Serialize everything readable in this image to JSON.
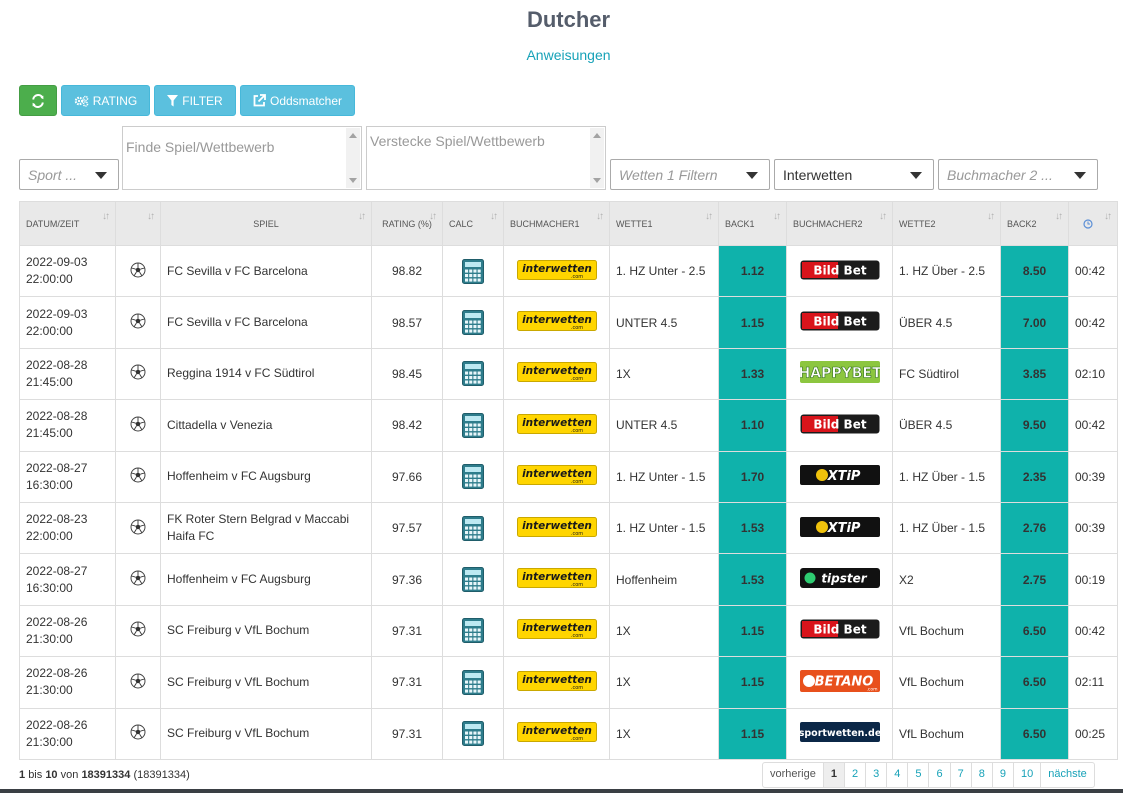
{
  "header": {
    "title": "Dutcher",
    "instructions_link": "Anweisungen"
  },
  "toolbar": {
    "refresh_icon": "refresh-icon",
    "rating_label": "RATING",
    "filter_label": "FILTER",
    "oddsmatcher_label": "Oddsmatcher"
  },
  "filters": {
    "sport_placeholder": "Sport ...",
    "find_game_placeholder": "Finde Spiel/Wettbewerb",
    "hide_game_placeholder": "Verstecke Spiel/Wettbewerb",
    "bets_filter_placeholder": "Wetten 1 Filtern",
    "bookmaker1_value": "Interwetten",
    "bookmaker2_placeholder": "Buchmacher 2 ..."
  },
  "table": {
    "columns": [
      "DATUM/ZEIT",
      "",
      "SPIEL",
      "RATING (%)",
      "CALC",
      "BUCHMACHER1",
      "WETTE1",
      "BACK1",
      "BUCHMACHER2",
      "WETTE2",
      "BACK2",
      ""
    ],
    "rows": [
      {
        "date": "2022-09-03",
        "time": "22:00:00",
        "game": "FC Sevilla v FC Barcelona",
        "rating": "98.82",
        "bm1": "interwetten",
        "bet1": "1. HZ Unter - 2.5",
        "back1": "1.12",
        "bm2": "bildbet",
        "bet2": "1. HZ Über - 2.5",
        "back2": "8.50",
        "age": "00:42"
      },
      {
        "date": "2022-09-03",
        "time": "22:00:00",
        "game": "FC Sevilla v FC Barcelona",
        "rating": "98.57",
        "bm1": "interwetten",
        "bet1": "UNTER 4.5",
        "back1": "1.15",
        "bm2": "bildbet",
        "bet2": "ÜBER 4.5",
        "back2": "7.00",
        "age": "00:42"
      },
      {
        "date": "2022-08-28",
        "time": "21:45:00",
        "game": "Reggina 1914 v FC Südtirol",
        "rating": "98.45",
        "bm1": "interwetten",
        "bet1": "1X",
        "back1": "1.33",
        "bm2": "happybet",
        "bet2": "FC Südtirol",
        "back2": "3.85",
        "age": "02:10"
      },
      {
        "date": "2022-08-28",
        "time": "21:45:00",
        "game": "Cittadella v Venezia",
        "rating": "98.42",
        "bm1": "interwetten",
        "bet1": "UNTER 4.5",
        "back1": "1.10",
        "bm2": "bildbet",
        "bet2": "ÜBER 4.5",
        "back2": "9.50",
        "age": "00:42"
      },
      {
        "date": "2022-08-27",
        "time": "16:30:00",
        "game": "Hoffenheim v FC Augsburg",
        "rating": "97.66",
        "bm1": "interwetten",
        "bet1": "1. HZ Unter - 1.5",
        "back1": "1.70",
        "bm2": "xtip",
        "bet2": "1. HZ Über - 1.5",
        "back2": "2.35",
        "age": "00:39"
      },
      {
        "date": "2022-08-23",
        "time": "22:00:00",
        "game": "FK Roter Stern Belgrad v Maccabi Haifa FC",
        "rating": "97.57",
        "bm1": "interwetten",
        "bet1": "1. HZ Unter - 1.5",
        "back1": "1.53",
        "bm2": "xtip",
        "bet2": "1. HZ Über - 1.5",
        "back2": "2.76",
        "age": "00:39"
      },
      {
        "date": "2022-08-27",
        "time": "16:30:00",
        "game": "Hoffenheim v FC Augsburg",
        "rating": "97.36",
        "bm1": "interwetten",
        "bet1": "Hoffenheim",
        "back1": "1.53",
        "bm2": "tipster",
        "bet2": "X2",
        "back2": "2.75",
        "age": "00:19"
      },
      {
        "date": "2022-08-26",
        "time": "21:30:00",
        "game": "SC Freiburg v VfL Bochum",
        "rating": "97.31",
        "bm1": "interwetten",
        "bet1": "1X",
        "back1": "1.15",
        "bm2": "bildbet",
        "bet2": "VfL Bochum",
        "back2": "6.50",
        "age": "00:42"
      },
      {
        "date": "2022-08-26",
        "time": "21:30:00",
        "game": "SC Freiburg v VfL Bochum",
        "rating": "97.31",
        "bm1": "interwetten",
        "bet1": "1X",
        "back1": "1.15",
        "bm2": "betano",
        "bet2": "VfL Bochum",
        "back2": "6.50",
        "age": "02:11"
      },
      {
        "date": "2022-08-26",
        "time": "21:30:00",
        "game": "SC Freiburg v VfL Bochum",
        "rating": "97.31",
        "bm1": "interwetten",
        "bet1": "1X",
        "back1": "1.15",
        "bm2": "sportwetten",
        "bet2": "VfL Bochum",
        "back2": "6.50",
        "age": "00:25"
      }
    ]
  },
  "logos": {
    "interwetten": {
      "text": "interwetten",
      "sub": ".com"
    },
    "bildbet": {
      "text": "Bild Bet"
    },
    "happybet": {
      "text": "HAPPYBET"
    },
    "xtip": {
      "text": "XTiP"
    },
    "tipster": {
      "text": "tipster"
    },
    "betano": {
      "text": "BETANO",
      "sub": ".com"
    },
    "sportwetten": {
      "text": "sportwetten.de"
    }
  },
  "footer": {
    "info_from": "1",
    "info_to": "10",
    "info_total": "18391334",
    "info_filtered": "18391334",
    "info_bis": "bis",
    "info_von": "von",
    "prev_label": "vorherige",
    "next_label": "nächste",
    "pages": [
      "1",
      "2",
      "3",
      "4",
      "5",
      "6",
      "7",
      "8",
      "9",
      "10"
    ],
    "active_page": "1"
  },
  "colors": {
    "accent_teal": "#0fb2ab",
    "button_blue": "#5bc0de",
    "button_green": "#4cae4c",
    "link": "#17a2b8"
  }
}
